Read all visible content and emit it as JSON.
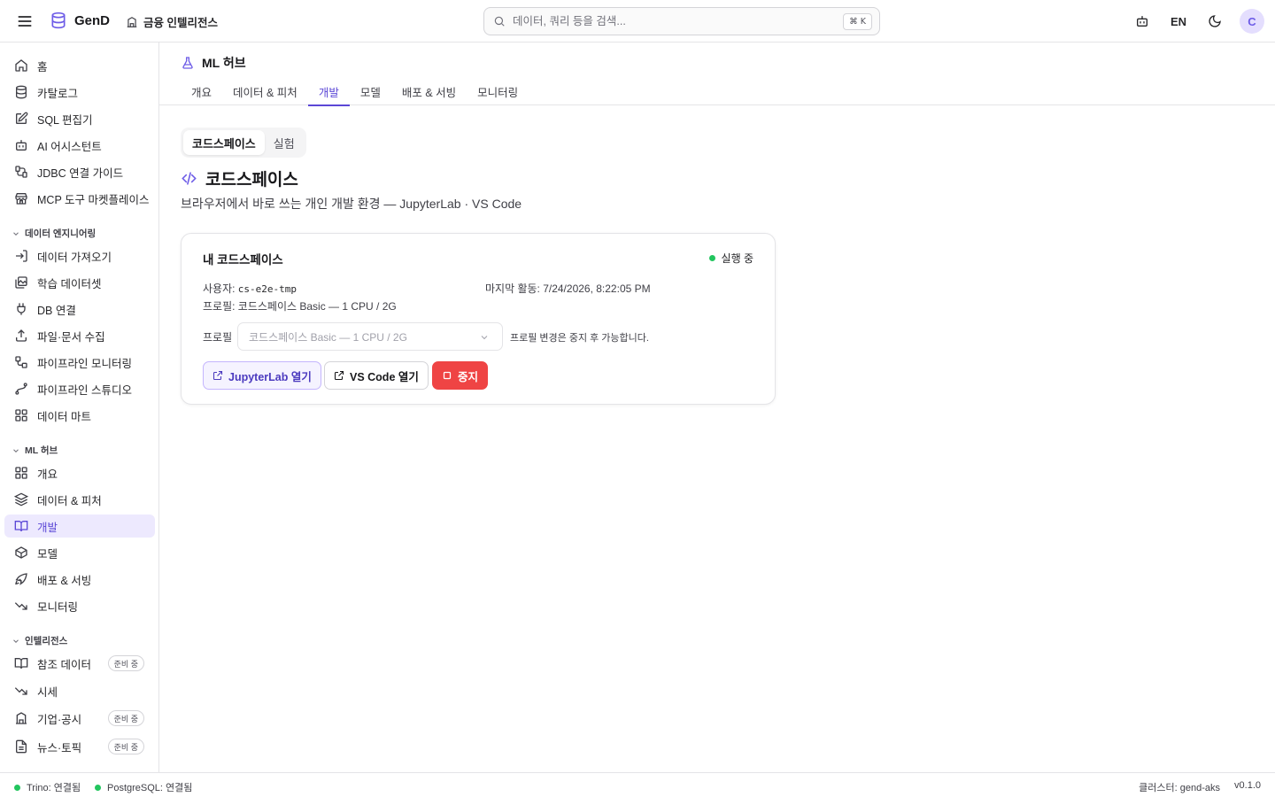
{
  "header": {
    "brand": "GenD",
    "workspace": "금융 인텔리전스",
    "search_placeholder": "데이터, 쿼리 등을 검색...",
    "search_shortcut": "⌘ K",
    "lang": "EN",
    "avatar_initial": "C"
  },
  "sidebar": {
    "top_items": [
      {
        "label": "홈",
        "icon": "home-icon"
      },
      {
        "label": "카탈로그",
        "icon": "database-icon"
      },
      {
        "label": "SQL 편집기",
        "icon": "edit-icon"
      },
      {
        "label": "AI 어시스턴트",
        "icon": "bot-icon"
      },
      {
        "label": "JDBC 연결 가이드",
        "icon": "connection-icon"
      },
      {
        "label": "MCP 도구 마켓플레이스",
        "icon": "store-icon"
      }
    ],
    "sections": [
      {
        "title": "데이터 엔지니어링",
        "items": [
          {
            "label": "데이터 가져오기",
            "icon": "import-icon"
          },
          {
            "label": "학습 데이터셋",
            "icon": "images-icon"
          },
          {
            "label": "DB 연결",
            "icon": "plug-icon"
          },
          {
            "label": "파일·문서 수집",
            "icon": "upload-icon"
          },
          {
            "label": "파이프라인 모니터링",
            "icon": "workflow-icon"
          },
          {
            "label": "파이프라인 스튜디오",
            "icon": "spline-icon"
          },
          {
            "label": "데이터 마트",
            "icon": "grid-icon"
          }
        ]
      },
      {
        "title": "ML 허브",
        "items": [
          {
            "label": "개요",
            "icon": "grid-icon"
          },
          {
            "label": "데이터 & 피처",
            "icon": "layers-icon"
          },
          {
            "label": "개발",
            "icon": "book-icon",
            "active": true
          },
          {
            "label": "모델",
            "icon": "box-icon"
          },
          {
            "label": "배포 & 서빙",
            "icon": "rocket-icon"
          },
          {
            "label": "모니터링",
            "icon": "trend-down-icon"
          }
        ]
      },
      {
        "title": "인텔리전스",
        "items": [
          {
            "label": "참조 데이터",
            "icon": "book-icon",
            "badge": "준비 중"
          },
          {
            "label": "시세",
            "icon": "trend-down-icon"
          },
          {
            "label": "기업·공시",
            "icon": "building-icon",
            "badge": "준비 중"
          },
          {
            "label": "뉴스·토픽",
            "icon": "file-icon",
            "badge": "준비 중"
          }
        ]
      }
    ]
  },
  "page": {
    "title": "ML 허브",
    "tabs": [
      "개요",
      "데이터 & 피처",
      "개발",
      "모델",
      "배포 & 서빙",
      "모니터링"
    ],
    "active_tab": "개발",
    "segments": [
      "코드스페이스",
      "실험"
    ],
    "active_segment": "코드스페이스",
    "section_title": "코드스페이스",
    "section_subtitle": "브라우저에서 바로 쓰는 개인 개발 환경 — JupyterLab · VS Code"
  },
  "card": {
    "title": "내 코드스페이스",
    "status": "실행 중",
    "status_color": "#22c55e",
    "user_label": "사용자: ",
    "user_value": "cs-e2e-tmp",
    "last_activity": "마지막 활동: 7/24/2026, 8:22:05 PM",
    "profile_info": "프로필: 코드스페이스 Basic — 1 CPU / 2G",
    "profile_label": "프로필",
    "profile_select_value": "코드스페이스 Basic — 1 CPU / 2G",
    "profile_hint": "프로필 변경은 중지 후 가능합니다.",
    "buttons": {
      "jupyter": "JupyterLab 열기",
      "vscode": "VS Code 열기",
      "stop": "중지"
    }
  },
  "footer": {
    "trino": "Trino: 연결됨",
    "postgres": "PostgreSQL: 연결됨",
    "cluster": "클러스터: gend-aks",
    "version": "v0.1.0"
  },
  "colors": {
    "accent": "#5b47d6",
    "danger": "#ef4444",
    "success": "#22c55e"
  }
}
